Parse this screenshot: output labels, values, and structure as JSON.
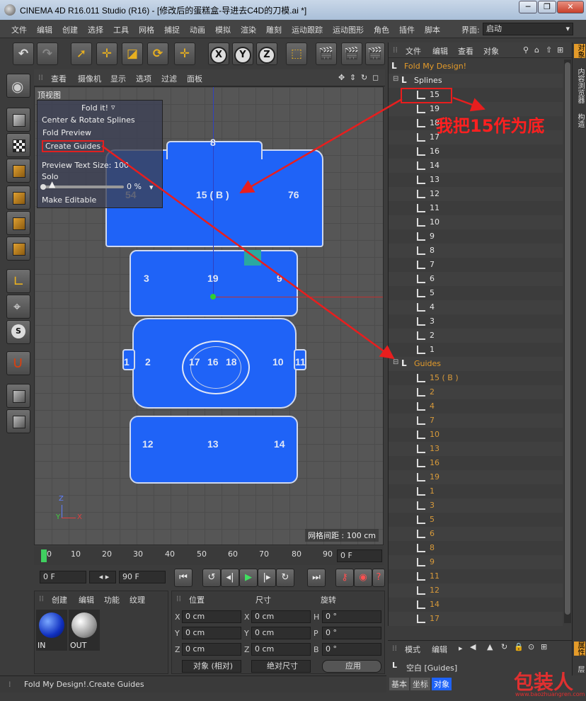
{
  "window": {
    "title": "CINEMA 4D R16.011 Studio (R16) - [修改后的蛋糕盒-导进去C4D的刀模.ai *]",
    "minimize": "─",
    "restore": "❐",
    "close": "✕"
  },
  "menubar": {
    "items": [
      "文件",
      "编辑",
      "创建",
      "选择",
      "工具",
      "网格",
      "捕捉",
      "动画",
      "模拟",
      "渲染",
      "雕刻",
      "运动跟踪",
      "运动图形",
      "角色",
      "插件",
      "脚本"
    ],
    "layout_label": "界面:",
    "layout_value": "启动"
  },
  "toolbar": {
    "axis_x": "X",
    "axis_y": "Y",
    "axis_z": "Z"
  },
  "viewport": {
    "menu": [
      "查看",
      "摄像机",
      "显示",
      "选项",
      "过滤",
      "面板"
    ],
    "view_label": "顶视图",
    "grid_spacing": "网格间距 : 100 cm",
    "axis_z": "Z",
    "axis_x": "X",
    "axis_y": "Y",
    "panels": [
      "8",
      "15 ( B )",
      "76",
      "54",
      "3",
      "19",
      "9",
      "1",
      "2",
      "17",
      "16",
      "18",
      "10",
      "11",
      "12",
      "13",
      "14"
    ]
  },
  "fold_panel": {
    "title": "Fold it!",
    "center_rotate": "Center & Rotate Splines",
    "fold_preview": "Fold Preview",
    "create_guides": "Create Guides",
    "preview_text_size_label": "Preview Text Size:",
    "preview_text_size_value": "100",
    "solo": "Solo",
    "slider_value": "0 %",
    "slider_fraction": 0,
    "make_editable": "Make Editable"
  },
  "timeline": {
    "ticks": [
      "0",
      "10",
      "20",
      "30",
      "40",
      "50",
      "60",
      "70",
      "80",
      "90"
    ],
    "current_frame": "0 F",
    "start_frame": "0 F",
    "end_frame": "90 F"
  },
  "material_panel": {
    "menu": [
      "创建",
      "编辑",
      "功能",
      "纹理"
    ],
    "materials": [
      "IN",
      "OUT"
    ]
  },
  "coord_panel": {
    "headers": [
      "位置",
      "尺寸",
      "旋转"
    ],
    "rows": [
      {
        "axis1": "X",
        "pos": "0 cm",
        "axis2": "X",
        "size": "0 cm",
        "axis3": "H",
        "rot": "0 °"
      },
      {
        "axis1": "Y",
        "pos": "0 cm",
        "axis2": "Y",
        "size": "0 cm",
        "axis3": "P",
        "rot": "0 °"
      },
      {
        "axis1": "Z",
        "pos": "0 cm",
        "axis2": "Z",
        "size": "0 cm",
        "axis3": "B",
        "rot": "0 °"
      }
    ],
    "mode_select": "对象 (相对)",
    "size_select": "绝对尺寸",
    "apply": "应用"
  },
  "statusbar": {
    "text": "Fold My Design!.Create Guides"
  },
  "object_manager": {
    "menu": [
      "文件",
      "编辑",
      "查看",
      "对象"
    ],
    "root": "Fold My Design!",
    "splines_group": "Splines",
    "splines": [
      "15",
      "19",
      "18",
      "17",
      "16",
      "14",
      "13",
      "12",
      "11",
      "10",
      "9",
      "8",
      "7",
      "6",
      "5",
      "4",
      "3",
      "2",
      "1"
    ],
    "guides_group": "Guides",
    "guides": [
      "15 ( B )",
      "2",
      "4",
      "7",
      "10",
      "13",
      "16",
      "19",
      "1",
      "3",
      "5",
      "6",
      "8",
      "9",
      "11",
      "12",
      "14",
      "17"
    ]
  },
  "attributes": {
    "menu": [
      "模式",
      "编辑"
    ],
    "object_label": "空白 [Guides]",
    "tabs": [
      "基本",
      "坐标",
      "对象"
    ]
  },
  "side_tabs": [
    "对象",
    "内容浏览器",
    "构造",
    "属性",
    "层"
  ],
  "annotation": {
    "text": "我把15作为底"
  },
  "watermark": {
    "text": "包装人",
    "url": "www.baozhuangren.com"
  },
  "colors": {
    "panel_blue": "#1f63f7",
    "annotation_red": "#ff2020",
    "object_orange": "#e49b2a",
    "active_tab": "#1f63f7"
  }
}
